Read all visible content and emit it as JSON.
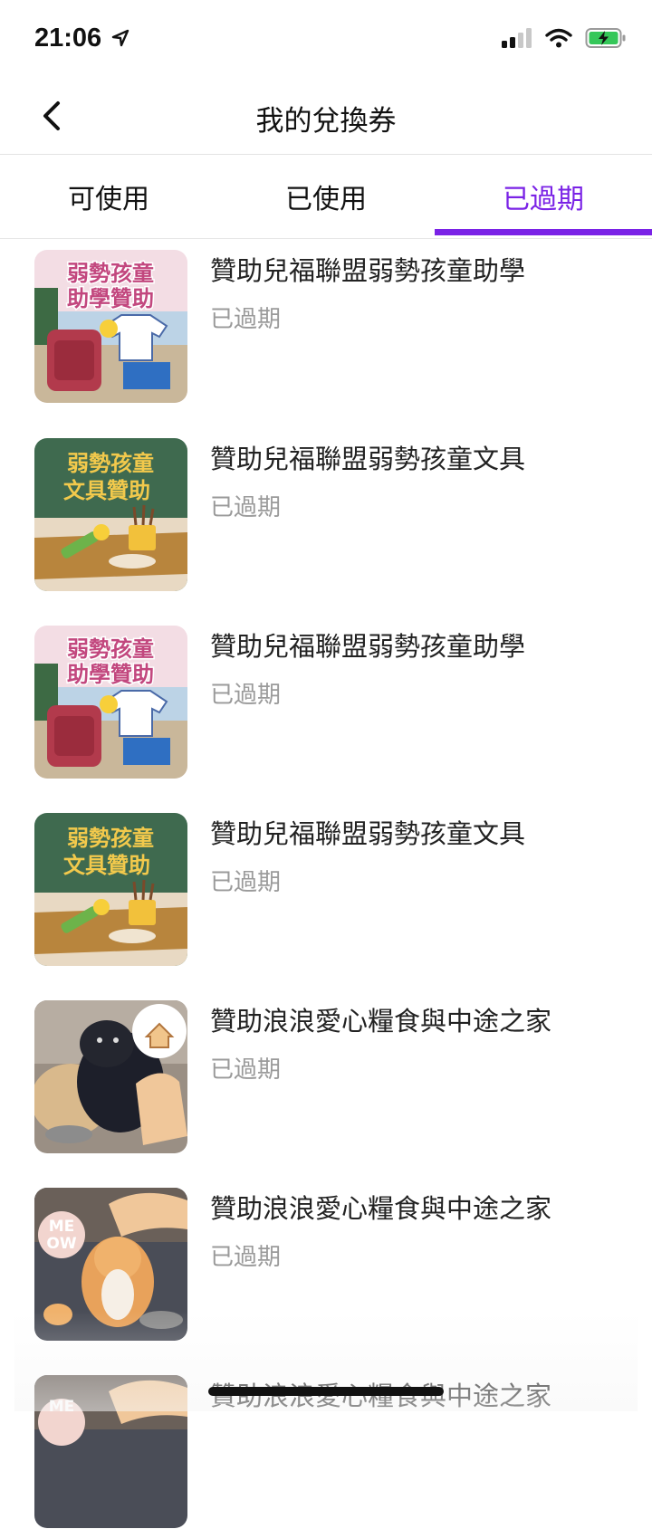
{
  "status_bar": {
    "time": "21:06"
  },
  "header": {
    "title": "我的兌換券"
  },
  "tabs": [
    {
      "label": "可使用"
    },
    {
      "label": "已使用"
    },
    {
      "label": "已過期"
    }
  ],
  "items": [
    {
      "title": "贊助兒福聯盟弱勢孩童助學",
      "status": "已過期",
      "thumb_caption": [
        "弱勢孩童",
        "助學贊助"
      ]
    },
    {
      "title": "贊助兒福聯盟弱勢孩童文具",
      "status": "已過期",
      "thumb_caption": [
        "弱勢孩童",
        "文具贊助"
      ]
    },
    {
      "title": "贊助兒福聯盟弱勢孩童助學",
      "status": "已過期",
      "thumb_caption": [
        "弱勢孩童",
        "助學贊助"
      ]
    },
    {
      "title": "贊助兒福聯盟弱勢孩童文具",
      "status": "已過期",
      "thumb_caption": [
        "弱勢孩童",
        "文具贊助"
      ]
    },
    {
      "title": "贊助浪浪愛心糧食與中途之家",
      "status": "已過期",
      "thumb_caption": []
    },
    {
      "title": "贊助浪浪愛心糧食與中途之家",
      "status": "已過期",
      "thumb_caption": [
        "ME",
        "OW"
      ]
    },
    {
      "title": "贊助浪浪愛心糧食與中途之家",
      "status": "",
      "thumb_caption": [
        "ME"
      ]
    }
  ],
  "colors": {
    "accent": "#7a22e6",
    "muted": "#9a9a9a"
  }
}
